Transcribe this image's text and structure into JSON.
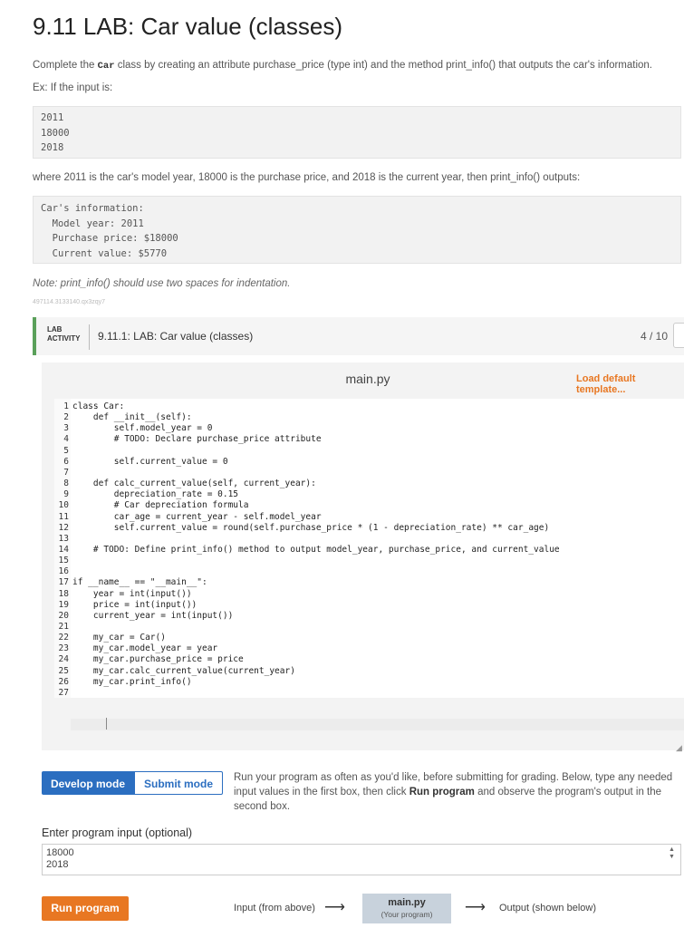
{
  "page": {
    "title": "9.11 LAB: Car value (classes)",
    "intro_before": "Complete the ",
    "intro_code": "Car",
    "intro_after": " class by creating an attribute purchase_price (type int) and the method print_info() that outputs the car's information.",
    "example_label": "Ex: If the input is:",
    "example_input": "2011\n18000\n2018",
    "where_text": "where 2011 is the car's model year, 18000 is the purchase price, and 2018 is the current year, then print_info() outputs:",
    "example_output": "Car's information:\n  Model year: 2011\n  Purchase price: $18000\n  Current value: $5770",
    "note": "Note: print_info() should use two spaces for indentation.",
    "tracking_id": "497114.3133140.qx3zqy7"
  },
  "lab": {
    "tag_line1": "LAB",
    "tag_line2": "ACTIVITY",
    "activity_title": "9.11.1: LAB: Car value (classes)",
    "score": "4 / 10"
  },
  "editor": {
    "filename": "main.py",
    "load_template": "Load default template...",
    "lines": [
      "class Car:",
      "    def __init__(self):",
      "        self.model_year = 0",
      "        # TODO: Declare purchase_price attribute",
      "",
      "        self.current_value = 0",
      "",
      "    def calc_current_value(self, current_year):",
      "        depreciation_rate = 0.15",
      "        # Car depreciation formula",
      "        car_age = current_year - self.model_year",
      "        self.current_value = round(self.purchase_price * (1 - depreciation_rate) ** car_age)",
      "",
      "    # TODO: Define print_info() method to output model_year, purchase_price, and current_value",
      "",
      "",
      "if __name__ == \"__main__\":",
      "    year = int(input())",
      "    price = int(input())",
      "    current_year = int(input())",
      "",
      "    my_car = Car()",
      "    my_car.model_year = year",
      "    my_car.purchase_price = price",
      "    my_car.calc_current_value(current_year)",
      "    my_car.print_info()",
      ""
    ]
  },
  "modes": {
    "develop_label": "Develop mode",
    "submit_label": "Submit mode",
    "description_a": "Run your program as often as you'd like, before submitting for grading. Below, type any needed input values in the first box, then click ",
    "description_bold": "Run program",
    "description_b": " and observe the program's output in the second box."
  },
  "input": {
    "label": "Enter program input (optional)",
    "value": "18000\n2018"
  },
  "run": {
    "button_label": "Run program",
    "flow_input_label": "Input (from above)",
    "program_file": "main.py",
    "program_sub": "(Your program)",
    "flow_output_label": "Output (shown below)"
  },
  "colors": {
    "accent_blue": "#2b6ec0",
    "accent_orange": "#e87722",
    "lab_green": "#5aa05a"
  }
}
